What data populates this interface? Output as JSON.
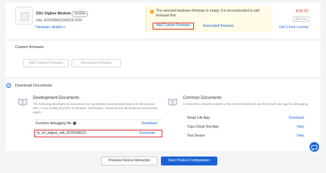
{
  "module": {
    "name": "ZSU Zigbee Module",
    "badge": "module",
    "chip_line": "chip: EFR32MG21A020F1024",
    "details_link": "Hardware details>>"
  },
  "warning": {
    "text": "The selected hardware firmware is empty. It is recommended to add firmware first",
    "add_custom_label": "Add Custom Firmware",
    "associated_label": "Associated firmware"
  },
  "purchase": {
    "price": "¥28.00",
    "buy_label": "Buy now",
    "license_link": "Get 2 Free License"
  },
  "custom_firmware": {
    "title": "Custom firmware",
    "add_label": "Add Custom Firmware",
    "associated_label": "Associated firmware"
  },
  "download_docs": {
    "step": "3",
    "title": "Download Documents",
    "development": {
      "title": "Development Documents",
      "description": "The following development documents are generated automatically based on the product DPs. If you modify any DPs or firmware information, download the development documents again.",
      "rows": [
        {
          "label": "Function debugging file",
          "link": "Download"
        },
        {
          "label": "ty_iot_zigbee_sdk_EFR32MG21",
          "link": "Download"
        }
      ]
    },
    "common": {
      "title": "Common Documents",
      "description": "Connect the network module to the control board and use the Smart Life app for debugging.",
      "rows": [
        {
          "label": "Smart Life App",
          "link": "Download"
        },
        {
          "label": "Tuya Cloud Test App",
          "link": "View"
        },
        {
          "label": "Test Device",
          "link": "View"
        }
      ]
    }
  },
  "footer": {
    "prev_label": "Previous Device Interaction",
    "next_label": "Next Product Configuration"
  },
  "icons": [
    "chip-image-icon",
    "warning-icon",
    "info-icon",
    "book-icon",
    "chat-icon"
  ],
  "colors": {
    "accent": "#1a63d4",
    "price": "#e24c2a",
    "highlight_box": "#dd2222",
    "warning_bg": "#fffbe6"
  }
}
